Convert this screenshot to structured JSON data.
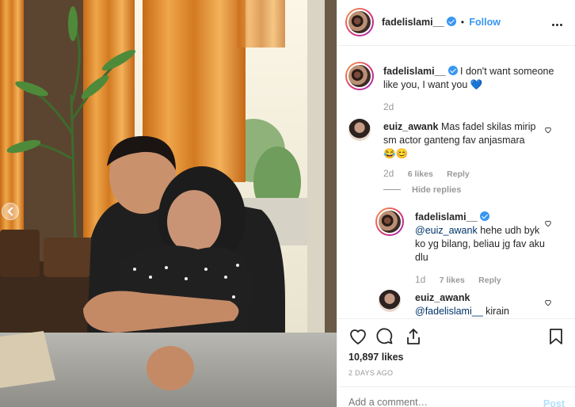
{
  "post": {
    "author": "fadelislami__",
    "follow_label": "Follow",
    "caption": "I don't want someone like you, I want you",
    "caption_emoji": "💙",
    "caption_age": "2d",
    "likes": "10,897 likes",
    "posted_ago": "2 DAYS AGO"
  },
  "comments": [
    {
      "username": "euiz_awank",
      "text": "Mas fadel skilas mirip sm actor ganteng fav anjasmara",
      "emoji": "😂😊",
      "age": "2d",
      "likes": "6 likes",
      "reply_label": "Reply",
      "hide_replies_label": "Hide replies",
      "replies": [
        {
          "username": "fadelislami__",
          "mention": "@euiz_awank",
          "text": "hehe udh byk ko yg bilang, beliau jg fav aku dlu",
          "age": "1d",
          "likes": "7 likes",
          "reply_label": "Reply"
        },
        {
          "username": "euiz_awank",
          "mention": "@fadelislami__",
          "text": "kirain"
        }
      ]
    }
  ],
  "composer": {
    "placeholder": "Add a comment…",
    "post_label": "Post"
  },
  "icons": {
    "verified": "verified-badge-icon",
    "more": "more-options-icon",
    "like": "heart-icon",
    "comment": "comment-icon",
    "share": "share-icon",
    "save": "bookmark-icon"
  },
  "colors": {
    "accent": "#3897f0",
    "muted": "#999999",
    "border": "#efefef"
  }
}
